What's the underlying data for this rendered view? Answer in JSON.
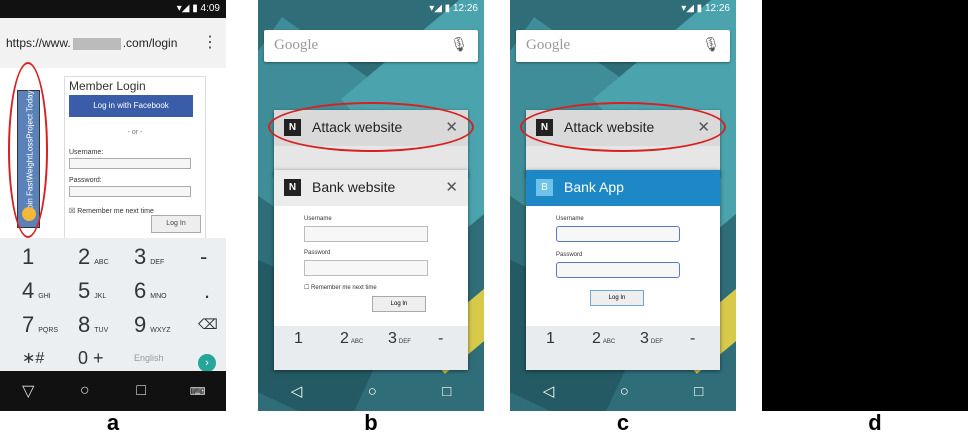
{
  "panels": {
    "a": {
      "caption": "a",
      "status_time": "4:09",
      "url_prefix": "https://www.",
      "url_suffix": ".com/login",
      "ad_text": "Join FastWeightLossProject Today!",
      "form_title": "Member Login",
      "facebook_button": "Log in with Facebook",
      "or_text": "- or -",
      "username_label": "Username:",
      "password_label": "Password:",
      "remember_text": "Remember me next time",
      "login_button": "Log In",
      "keys": [
        {
          "n": "1",
          "l": ""
        },
        {
          "n": "2",
          "l": "ABC"
        },
        {
          "n": "3",
          "l": "DEF"
        },
        {
          "n": "-",
          "l": ""
        },
        {
          "n": "4",
          "l": "GHI"
        },
        {
          "n": "5",
          "l": "JKL"
        },
        {
          "n": "6",
          "l": "MNO"
        },
        {
          "n": ".",
          "l": ""
        },
        {
          "n": "7",
          "l": "PQRS"
        },
        {
          "n": "8",
          "l": "TUV"
        },
        {
          "n": "9",
          "l": "WXYZ"
        },
        {
          "n": "⌫",
          "l": ""
        },
        {
          "n": "∗#",
          "l": ""
        },
        {
          "n": "0 +",
          "l": ""
        },
        {
          "n": "English",
          "l": ""
        }
      ]
    },
    "b": {
      "caption": "b",
      "status_time": "12:26",
      "google_label": "Google",
      "card_top_title": "Attack website",
      "card_top_icon": "N",
      "card_bottom_title": "Bank website",
      "card_bottom_icon": "N",
      "username_label": "Username",
      "password_label": "Password",
      "remember_text": "Remember me next time",
      "login_button": "Log In",
      "keys": [
        {
          "n": "1",
          "l": ""
        },
        {
          "n": "2",
          "l": "ABC"
        },
        {
          "n": "3",
          "l": "DEF"
        },
        {
          "n": "-",
          "l": ""
        }
      ]
    },
    "c": {
      "caption": "c",
      "status_time": "12:26",
      "google_label": "Google",
      "card_top_title": "Attack website",
      "card_top_icon": "N",
      "card_bottom_title": "Bank App",
      "card_bottom_icon": "B",
      "username_label": "Username",
      "password_label": "Password",
      "login_button": "Log In",
      "keys": [
        {
          "n": "1",
          "l": ""
        },
        {
          "n": "2",
          "l": "ABC"
        },
        {
          "n": "3",
          "l": "DEF"
        },
        {
          "n": "-",
          "l": ""
        }
      ]
    },
    "d": {
      "caption": "d"
    }
  },
  "colors": {
    "highlight_oval": "#d82020",
    "facebook_blue": "#3b5ca8",
    "bank_app_blue": "#1e88c7"
  }
}
